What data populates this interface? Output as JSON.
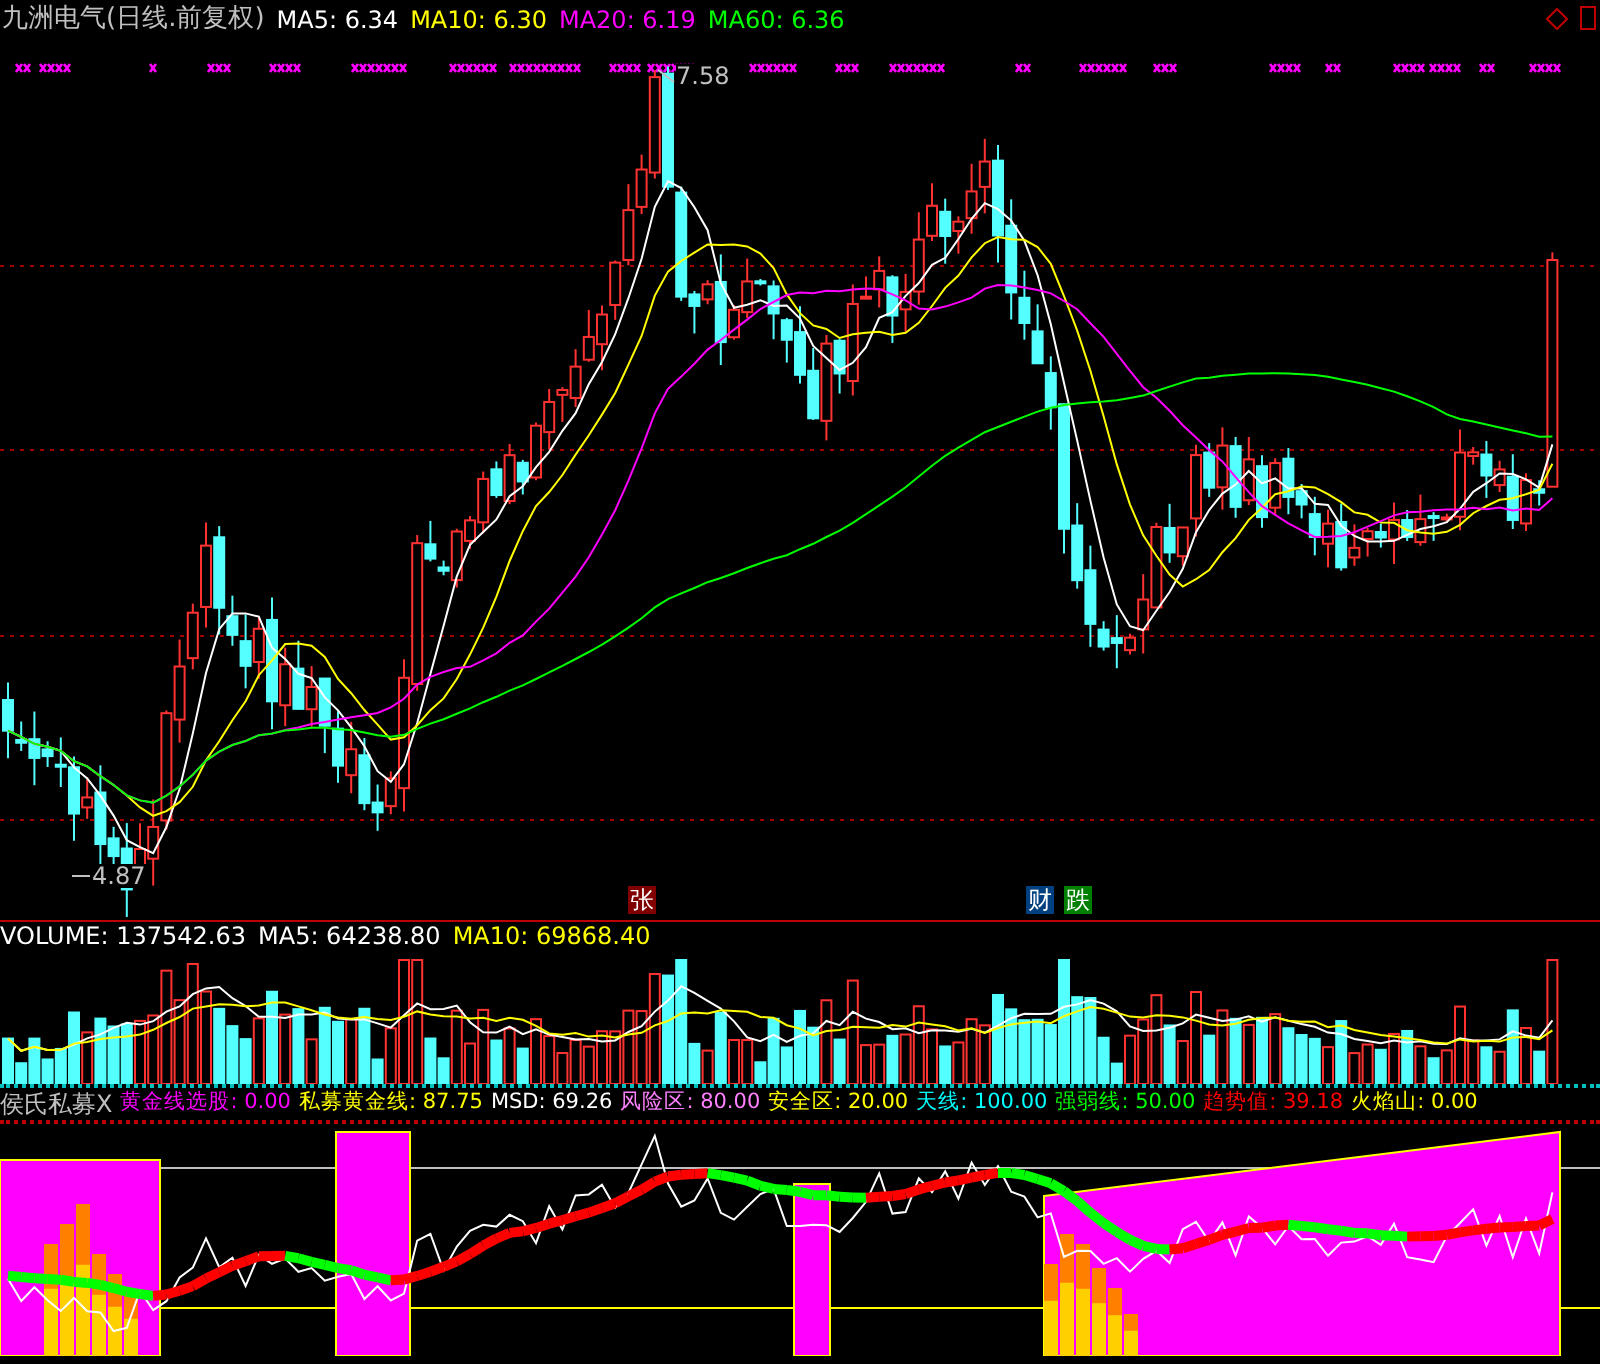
{
  "chart_title": "九洲电气(日线.前复权)",
  "ma_readouts": [
    {
      "text": "MA5: 6.34",
      "color": "#ffffff"
    },
    {
      "text": "MA10: 6.30",
      "color": "#ffff00"
    },
    {
      "text": "MA20: 6.19",
      "color": "#ff00ff"
    },
    {
      "text": "MA60: 6.36",
      "color": "#00ff00"
    }
  ],
  "price_labels": [
    {
      "kind": "high",
      "text": "7.58"
    },
    {
      "kind": "low",
      "text": "4.87"
    }
  ],
  "signal_badges": [
    {
      "text": "张",
      "color": "#800000"
    },
    {
      "text": "财",
      "color": "#004080"
    },
    {
      "text": "跌",
      "color": "#008000"
    }
  ],
  "volume_readouts": [
    {
      "text": "VOLUME: 137542.63",
      "color": "#ffffff"
    },
    {
      "text": "MA5: 64238.80",
      "color": "#ffffff"
    },
    {
      "text": "MA10: 69868.40",
      "color": "#ffff00"
    }
  ],
  "indicator": {
    "name": "侯氏私募X",
    "readouts": [
      {
        "text": "黄金线选股: 0.00",
        "color": "#ff00ff"
      },
      {
        "text": "私募黄金线: 87.75",
        "color": "#ffff00"
      },
      {
        "text": "MSD: 69.26",
        "color": "#ffffff"
      },
      {
        "text": "风险区: 80.00",
        "color": "#ff80ff"
      },
      {
        "text": "安全区: 20.00",
        "color": "#ffff00"
      },
      {
        "text": "天线: 100.00",
        "color": "#00ffff"
      },
      {
        "text": "强弱线: 50.00",
        "color": "#00ff00"
      },
      {
        "text": "趋势值: 39.18",
        "color": "#ff0000"
      },
      {
        "text": "火焰山: 0.00",
        "color": "#ffff00"
      }
    ]
  }
}
